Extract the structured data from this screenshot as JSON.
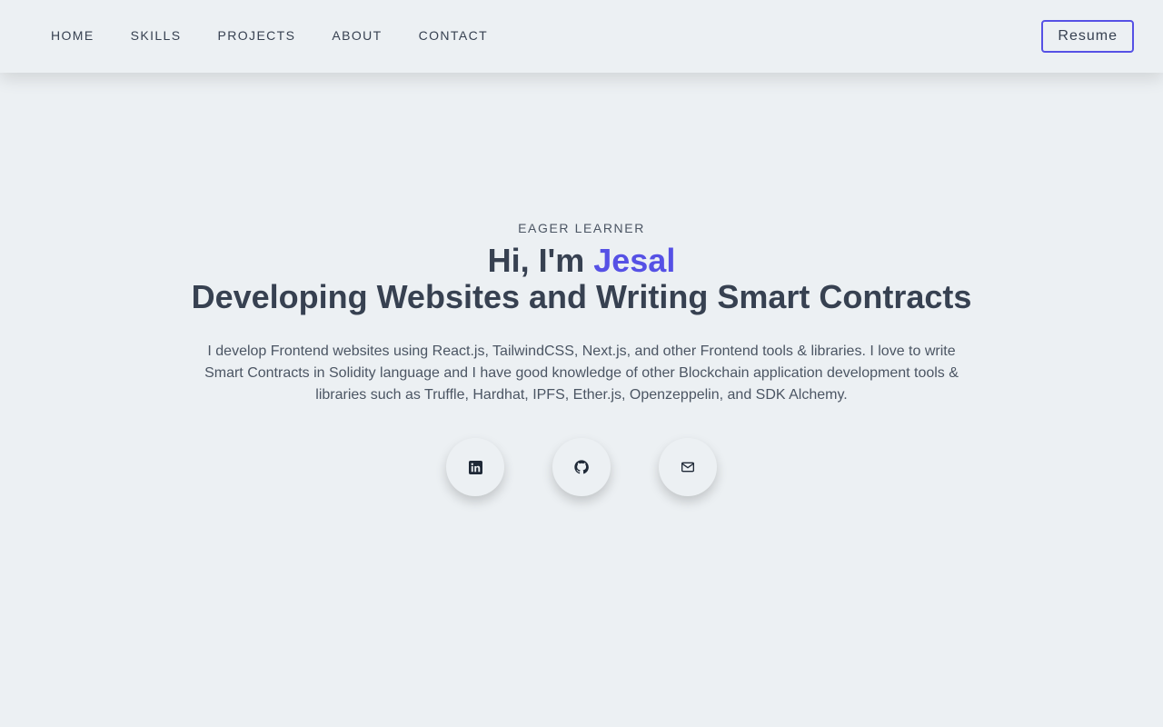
{
  "nav": {
    "links": [
      "HOME",
      "SKILLS",
      "PROJECTS",
      "ABOUT",
      "CONTACT"
    ],
    "resume_label": "Resume"
  },
  "hero": {
    "tagline": "EAGER LEARNER",
    "greeting": "Hi, I'm ",
    "name": "Jesal",
    "headline": "Developing Websites and Writing Smart Contracts",
    "description": "I develop Frontend websites using React.js, TailwindCSS, Next.js, and other Frontend tools & libraries. I love to write Smart Contracts in Solidity language and I have good knowledge of other Blockchain application development tools & libraries such as Truffle, Hardhat, IPFS, Ether.js, Openzeppelin, and SDK Alchemy."
  },
  "socials": [
    {
      "icon": "linkedin-icon"
    },
    {
      "icon": "github-icon"
    },
    {
      "icon": "mail-icon"
    }
  ],
  "colors": {
    "background": "#ecf0f3",
    "accent": "#5651e5",
    "text": "#374151"
  }
}
